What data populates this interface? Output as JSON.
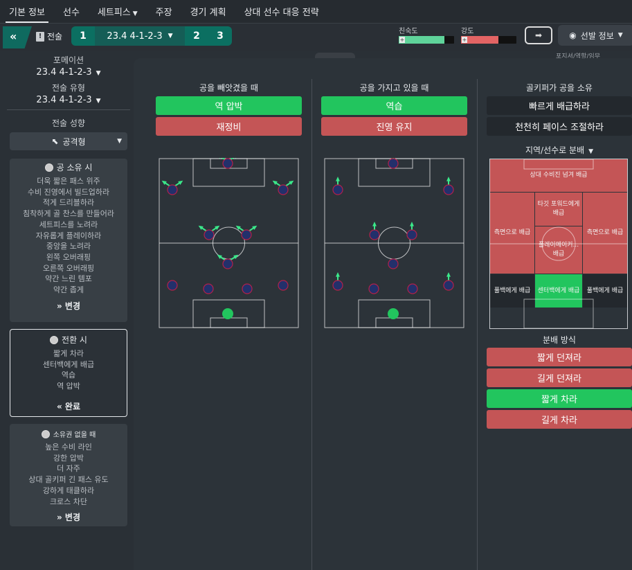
{
  "tabs": [
    {
      "label": "기본 정보",
      "active": true
    },
    {
      "label": "선수"
    },
    {
      "label": "세트피스",
      "chevron": true
    },
    {
      "label": "주장"
    },
    {
      "label": "경기 계획"
    },
    {
      "label": "상대 선수 대응 전략"
    }
  ],
  "toolbar": {
    "back_glyph": "«",
    "tactic_label": "전술",
    "slot1": "1",
    "slot_name": "23.4 4-1-2-3",
    "slot2": "2",
    "slot3": "3",
    "familiarity_label": "친숙도",
    "familiarity_value": 0.82,
    "familiarity_color": "#5fd39a",
    "intensity_label": "강도",
    "intensity_value": 0.67,
    "intensity_color": "#e36464",
    "lineup_label": "선발 정보",
    "peek_text": "포지셔/역할/임무"
  },
  "sidebar": {
    "formation_label": "포메이션",
    "formation_value": "23.4 4-1-2-3",
    "tactic_type_label": "전술 유형",
    "tactic_type_value": "23.4 4-1-2-3",
    "mentality_label": "전술 성향",
    "mentality_value": "공격형",
    "in_possession": {
      "title": "공 소유 시",
      "lines": [
        "더욱 짧은 패스 위주",
        "수비 진영에서 빌드업하라",
        "적게 드리블하라",
        "침착하게 골 찬스를 만들어라",
        "세트피스를 노려라",
        "자유롭게 플레이하라",
        "중앙을 노려라",
        "왼쪽 오버래핑",
        "오른쪽 오버래핑",
        "약간 느린 템포",
        "약간 좁게"
      ],
      "action": "변경"
    },
    "in_transition": {
      "title": "전환 시",
      "lines": [
        "짧게 차라",
        "센터백에게 배급",
        "역습",
        "역 압박"
      ],
      "action": "완료"
    },
    "out_of_possession": {
      "title": "소유권 없을 때",
      "lines": [
        "높은 수비 라인",
        "강한 압박",
        "더 자주",
        "상대 골키퍼 긴 패스 유도",
        "강하게 태클하라",
        "크로스 차단"
      ],
      "action": "변경"
    }
  },
  "columns": {
    "lost": {
      "title": "공을 빼앗겼을 때",
      "green": "역 압박",
      "red": "재정비"
    },
    "won": {
      "title": "공을 가지고 있을 때",
      "green": "역습",
      "red": "진영 유지"
    },
    "gk": {
      "title": "골키퍼가 공을 소유",
      "opt1": "빠르게 배급하라",
      "opt2": "천천히 페이스 조절하라"
    }
  },
  "distribution": {
    "title": "지역/선수로 분배",
    "zones": {
      "over_defense": "상대 수비진 넘겨 배급",
      "target_forward": "타깃 포워드에게 배급",
      "flank_left": "측면으로 배급",
      "flank_right": "측면으로 배급",
      "playmaker": "플레이메이커... 배급",
      "fullback_left": "풀백에게 배급",
      "centre_back": "센터백에게 배급",
      "fullback_right": "풀백에게 배급"
    },
    "method_title": "분배 방식",
    "methods": [
      {
        "label": "짧게 던져라",
        "state": "red"
      },
      {
        "label": "길게 던져라",
        "state": "red"
      },
      {
        "label": "짧게 차라",
        "state": "green"
      },
      {
        "label": "길게 차라",
        "state": "red"
      }
    ]
  },
  "colors": {
    "green": "#22c55e",
    "red": "#c45556",
    "arrow": "#3be88a",
    "player": "#23306b",
    "player_ring": "#b3204a"
  }
}
